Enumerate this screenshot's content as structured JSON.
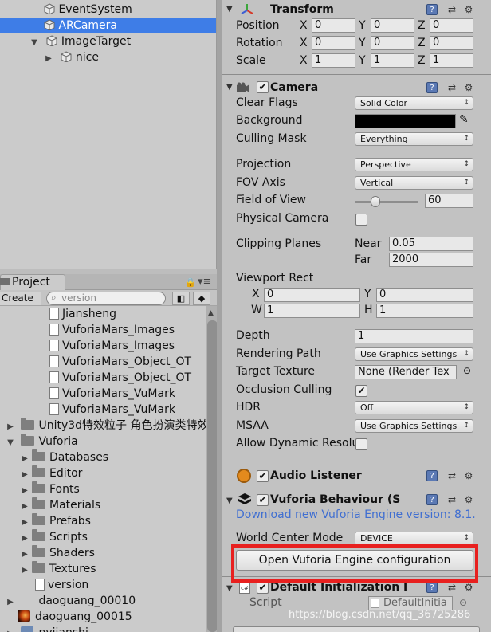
{
  "hierarchy": {
    "items": [
      {
        "label": "EventSystem"
      },
      {
        "label": "ARCamera"
      },
      {
        "label": "ImageTarget"
      },
      {
        "label": "nice"
      }
    ]
  },
  "project": {
    "tab_label": "Project",
    "create_label": "Create ▾",
    "search_placeholder": "version",
    "files": [
      "Jiansheng",
      "VuforiaMars_Images",
      "VuforiaMars_Images",
      "VuforiaMars_Object_OT",
      "VuforiaMars_Object_OT",
      "VuforiaMars_VuMark",
      "VuforiaMars_VuMark"
    ],
    "top_folders": [
      "Unity3d特效粒子 角色扮演类特效",
      "Vuforia"
    ],
    "vuforia_children": [
      "Databases",
      "Editor",
      "Fonts",
      "Materials",
      "Prefabs",
      "Scripts",
      "Shaders",
      "Textures"
    ],
    "version_file": "version",
    "bottom_items": [
      "daoguang_00010",
      "daoguang_00015",
      "nvjianshi"
    ]
  },
  "transform": {
    "title": "Transform",
    "rows": [
      {
        "label": "Position",
        "x": "0",
        "y": "0",
        "z": "0"
      },
      {
        "label": "Rotation",
        "x": "0",
        "y": "0",
        "z": "0"
      },
      {
        "label": "Scale",
        "x": "1",
        "y": "1",
        "z": "1"
      }
    ],
    "axis_x": "X",
    "axis_y": "Y",
    "axis_z": "Z"
  },
  "camera": {
    "title": "Camera",
    "clear_flags_label": "Clear Flags",
    "clear_flags_value": "Solid Color",
    "background_label": "Background",
    "background_color": "#000000",
    "culling_mask_label": "Culling Mask",
    "culling_mask_value": "Everything",
    "projection_label": "Projection",
    "projection_value": "Perspective",
    "fov_axis_label": "FOV Axis",
    "fov_axis_value": "Vertical",
    "fov_label": "Field of View",
    "fov_value": "60",
    "fov_slider_fraction": 0.33,
    "physical_camera_label": "Physical Camera",
    "clipping_label": "Clipping Planes",
    "near_label": "Near",
    "near_value": "0.05",
    "far_label": "Far",
    "far_value": "2000",
    "viewport_label": "Viewport Rect",
    "vp_x_label": "X",
    "vp_x": "0",
    "vp_y_label": "Y",
    "vp_y": "0",
    "vp_w_label": "W",
    "vp_w": "1",
    "vp_h_label": "H",
    "vp_h": "1",
    "depth_label": "Depth",
    "depth_value": "1",
    "rendering_path_label": "Rendering Path",
    "rendering_path_value": "Use Graphics Settings",
    "target_texture_label": "Target Texture",
    "target_texture_value": "None (Render Tex",
    "occlusion_label": "Occlusion Culling",
    "hdr_label": "HDR",
    "hdr_value": "Off",
    "msaa_label": "MSAA",
    "msaa_value": "Use Graphics Settings",
    "dynamic_res_label": "Allow Dynamic Resolu"
  },
  "audio_listener": {
    "title": "Audio Listener"
  },
  "vuforia": {
    "title": "Vuforia Behaviour (S",
    "download_link": "Download new Vuforia Engine version: 8.1.",
    "world_center_label": "World Center Mode",
    "world_center_value": "DEVICE",
    "open_config_label": "Open Vuforia Engine configuration"
  },
  "default_init": {
    "title": "Default Initialization I",
    "script_label": "Script",
    "script_value": "DefaultInitia"
  },
  "watermark": "https://blog.csdn.net/qq_36725286",
  "colors": {
    "selection": "#3e7de7",
    "highlight_border": "#e8201f",
    "link": "#3f6ed1"
  }
}
